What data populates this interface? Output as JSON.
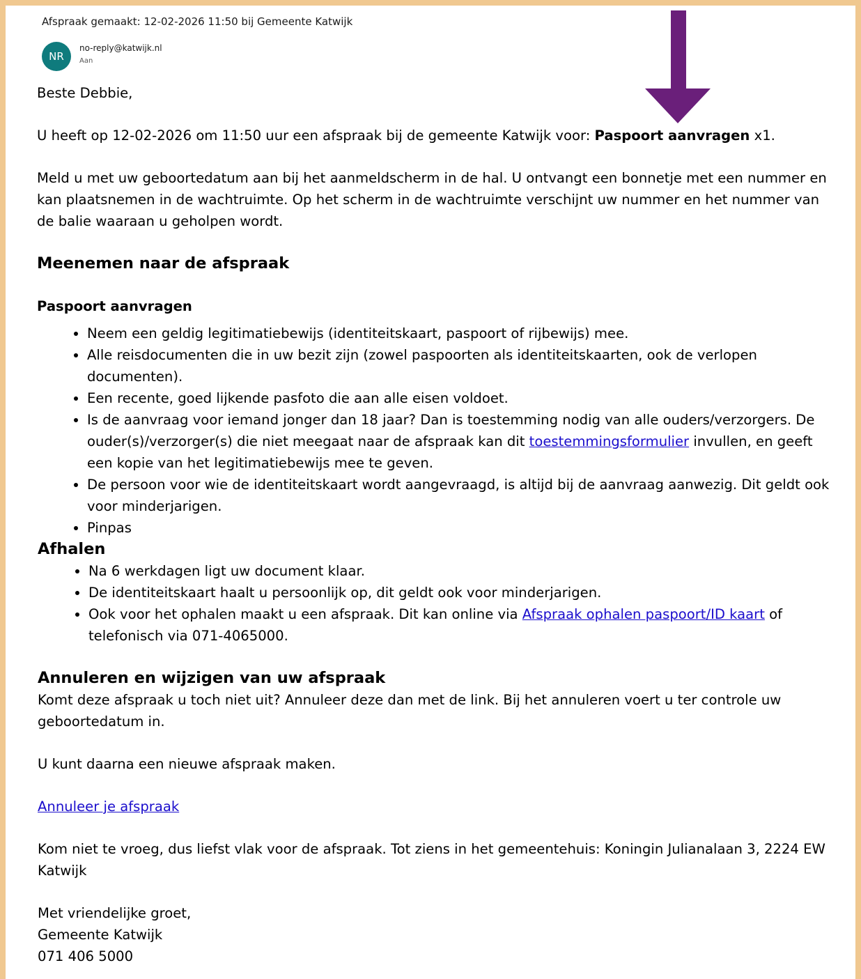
{
  "header": {
    "subject": "Afspraak gemaakt: 12-02-2026 11:50 bij Gemeente Katwijk",
    "avatar_initials": "NR",
    "avatar_color": "#0f7b7d",
    "sender": "no-reply@katwijk.nl",
    "to_label": "Aan"
  },
  "annotation": {
    "arrow_color": "#6a1f7a",
    "frame_color": "#f0c890"
  },
  "email": {
    "greeting": "Beste Debbie,",
    "intro_before": "U heeft op 12-02-2026 om 11:50 uur een afspraak bij de gemeente Katwijk voor: ",
    "intro_bold": "Paspoort aanvragen",
    "intro_after": " x1.",
    "checkin": "Meld u met uw geboortedatum aan bij het aanmeldscherm in de hal. U ontvangt een bonnetje met een nummer en kan plaatsnemen in de wachtruimte. Op het scherm in de wachtruimte verschijnt uw nummer en het nummer van de balie waaraan u geholpen wordt.",
    "bring_heading": "Meenemen naar de afspraak",
    "bring_subheading": "Paspoort aanvragen",
    "bring_items": {
      "i0": "Neem een geldig legitimatiebewijs (identiteitskaart, paspoort of rijbewijs) mee.",
      "i1": "Alle reisdocumenten die in uw bezit zijn (zowel paspoorten als identiteitskaarten, ook de verlopen documenten).",
      "i2": "Een recente, goed lijkende pasfoto die aan alle eisen voldoet.",
      "i3_before": "Is de aanvraag voor iemand jonger dan 18 jaar? Dan is toestemming nodig van alle ouders/verzorgers. De ouder(s)/verzorger(s) die niet meegaat naar de afspraak kan dit ",
      "i3_link": "toestemmingsformulier",
      "i3_after": " invullen, en geeft een kopie van het legitimatiebewijs mee te geven.",
      "i4": "De persoon voor wie de identiteitskaart wordt aangevraagd, is altijd bij de aanvraag aanwezig. Dit geldt ook voor minderjarigen.",
      "i5": "Pinpas"
    },
    "pickup_heading": "Afhalen",
    "pickup_items": {
      "i0": "Na 6 werkdagen ligt uw document klaar.",
      "i1": "De identiteitskaart haalt u persoonlijk op, dit geldt ook voor minderjarigen.",
      "i2_before": "Ook voor het ophalen maakt u een afspraak. Dit kan online via ",
      "i2_link": "Afspraak ophalen paspoort/ID kaart",
      "i2_after": " of telefonisch via 071-4065000."
    },
    "cancel_heading": "Annuleren en wijzigen van uw afspraak",
    "cancel_text": "Komt deze afspraak u toch niet uit? Annuleer deze dan met de link. Bij het annuleren voert u ter controle uw geboortedatum in.",
    "new_text": "U kunt daarna een nieuwe afspraak maken.",
    "cancel_link": "Annuleer je afspraak",
    "closing_text": "Kom niet te vroeg, dus liefst vlak voor de afspraak. Tot ziens in het gemeentehuis: Koningin Julianalaan 3, 2224 EW Katwijk",
    "sign_line1": "Met vriendelijke groet,",
    "sign_line2": "Gemeente Katwijk",
    "sign_line3": "071 406 5000"
  }
}
